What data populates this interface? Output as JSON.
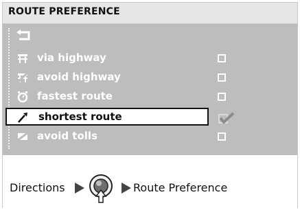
{
  "header": {
    "title": "ROUTE PREFERENCE"
  },
  "menu": {
    "back_icon": "back-arrow-icon",
    "options": [
      {
        "label": "via highway",
        "icon": "highway-icon",
        "checked": false,
        "selected": false
      },
      {
        "label": "avoid highway",
        "icon": "avoid-highway-icon",
        "checked": false,
        "selected": false
      },
      {
        "label": "fastest route",
        "icon": "stopwatch-icon",
        "checked": false,
        "selected": false
      },
      {
        "label": "shortest route",
        "icon": "compass-needle-icon",
        "checked": true,
        "selected": true
      },
      {
        "label": "avoid tolls",
        "icon": "avoid-toll-icon",
        "checked": false,
        "selected": false
      }
    ]
  },
  "breadcrumb": {
    "start": "Directions",
    "joystick_icon": "joystick-button-icon",
    "end": "Route Preference"
  },
  "colors": {
    "menu_background": "#bdbdbd",
    "header_background": "#e6e6e6",
    "menu_text": "#ffffff",
    "selected_border": "#111111"
  }
}
